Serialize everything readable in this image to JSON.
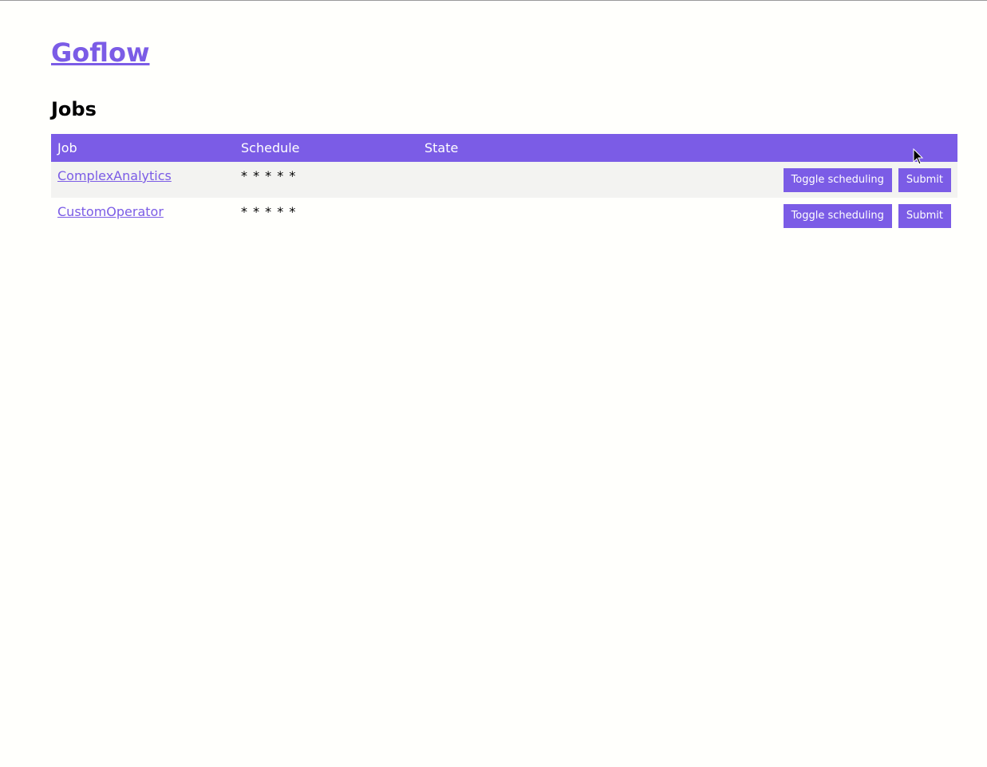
{
  "site": {
    "title": "Goflow"
  },
  "page": {
    "heading": "Jobs"
  },
  "table": {
    "headers": {
      "job": "Job",
      "schedule": "Schedule",
      "state": "State",
      "actions": ""
    },
    "rows": [
      {
        "job": "ComplexAnalytics",
        "schedule": "* * * * *",
        "state": "",
        "toggle_label": "Toggle scheduling",
        "submit_label": "Submit"
      },
      {
        "job": "CustomOperator",
        "schedule": "* * * * *",
        "state": "",
        "toggle_label": "Toggle scheduling",
        "submit_label": "Submit"
      }
    ]
  },
  "colors": {
    "accent": "#7b5ce6",
    "background": "#fffffc",
    "row_stripe": "#f3f3f1"
  },
  "cursor": {
    "icon": "mouse-pointer-icon"
  }
}
